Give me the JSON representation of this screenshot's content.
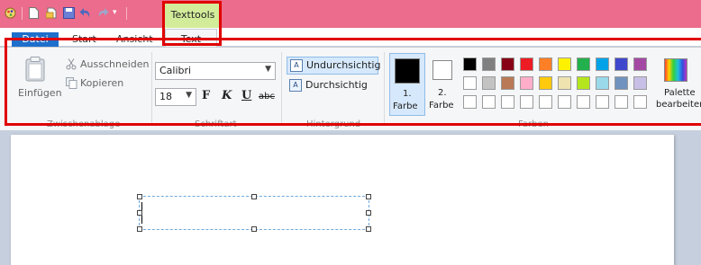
{
  "ribbon_tabs": {
    "file": "Datei",
    "start": "Start",
    "view": "Ansicht",
    "text": "Text",
    "contextual": "Texttools"
  },
  "clipboard": {
    "paste": "Einfügen",
    "cut": "Ausschneiden",
    "copy": "Kopieren",
    "group_label": "Zwischenablage"
  },
  "font": {
    "family": "Calibri",
    "size": "18",
    "bold": "F",
    "italic": "K",
    "underline": "U",
    "strikethrough": "abc",
    "group_label": "Schriftart"
  },
  "background": {
    "opaque": "Undurchsichtig",
    "transparent": "Durchsichtig",
    "group_label": "Hintergrund"
  },
  "colors": {
    "color1_num": "1.",
    "color1_word": "Farbe",
    "color2_num": "2.",
    "color2_word": "Farbe",
    "color1_value": "#000000",
    "color2_value": "#ffffff",
    "palette_row1": [
      "#000000",
      "#7f7f7f",
      "#880015",
      "#ed1c24",
      "#ff7f27",
      "#fff200",
      "#22b14c",
      "#00a2e8",
      "#3f48cc",
      "#a349a4"
    ],
    "palette_row2": [
      "#ffffff",
      "#c3c3c3",
      "#b97a57",
      "#ffaec9",
      "#ffc90e",
      "#efe4b0",
      "#b5e61d",
      "#99d9ea",
      "#7092be",
      "#c8bfe7"
    ],
    "palette_row3": [
      "#ffffff",
      "#ffffff",
      "#ffffff",
      "#ffffff",
      "#ffffff",
      "#ffffff",
      "#ffffff",
      "#ffffff",
      "#ffffff",
      "#ffffff"
    ],
    "edit_line1": "Palette",
    "edit_line2": "bearbeiten",
    "group_label": "Farben"
  }
}
